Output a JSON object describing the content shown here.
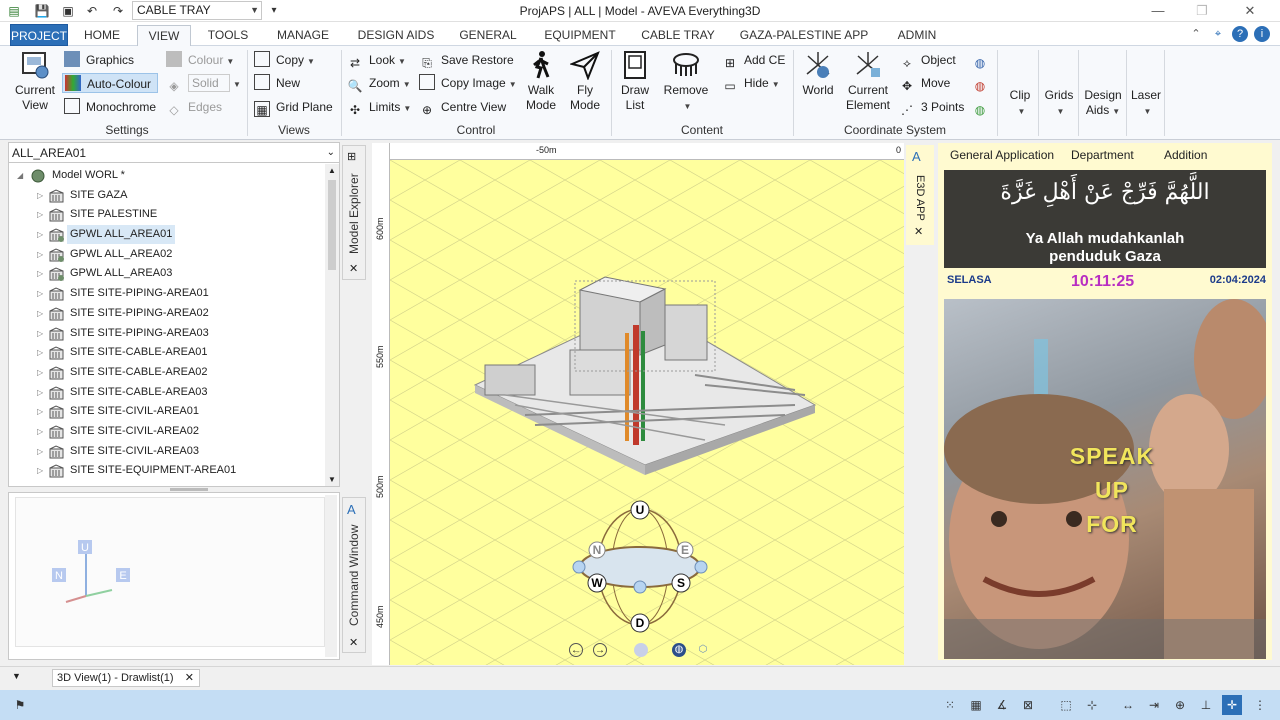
{
  "window": {
    "title": "ProjAPS | ALL | Model - AVEVA Everything3D",
    "context_combo": "CABLE TRAY"
  },
  "tabs": [
    "PROJECT",
    "HOME",
    "VIEW",
    "TOOLS",
    "MANAGE",
    "DESIGN AIDS",
    "GENERAL",
    "EQUIPMENT",
    "CABLE TRAY",
    "GAZA-PALESTINE APP",
    "ADMIN"
  ],
  "active_tab": "VIEW",
  "ribbon": {
    "settings": {
      "label": "Settings",
      "current_view": [
        "Current",
        "View"
      ],
      "graphics": "Graphics",
      "auto_colour": "Auto-Colour",
      "monochrome": "Monochrome",
      "colour": "Colour",
      "solid": "Solid",
      "edges": "Edges"
    },
    "views": {
      "label": "Views",
      "copy": "Copy",
      "new": "New",
      "grid_plane": "Grid Plane"
    },
    "control": {
      "label": "Control",
      "look": "Look",
      "zoom": "Zoom",
      "limits": "Limits",
      "save_restore": "Save Restore",
      "copy_image": "Copy Image",
      "centre_view": "Centre View",
      "walk_mode": [
        "Walk",
        "Mode"
      ],
      "fly_mode": [
        "Fly",
        "Mode"
      ]
    },
    "content": {
      "label": "Content",
      "draw_list": [
        "Draw",
        "List"
      ],
      "remove": "Remove",
      "add_ce": "Add CE",
      "hide": "Hide"
    },
    "coordinate": {
      "label": "Coordinate System",
      "world": "World",
      "current_element": [
        "Current",
        "Element"
      ],
      "object": "Object",
      "move": "Move",
      "three_points": "3 Points"
    },
    "clip": "Clip",
    "grids": "Grids",
    "design_aids": [
      "Design",
      "Aids"
    ],
    "laser": "Laser"
  },
  "explorer": {
    "combo": "ALL_AREA01",
    "side_tab": "Model Explorer",
    "root": "Model WORL *",
    "items": [
      "SITE GAZA",
      "SITE PALESTINE",
      "GPWL ALL_AREA01",
      "GPWL ALL_AREA02",
      "GPWL ALL_AREA03",
      "SITE SITE-PIPING-AREA01",
      "SITE SITE-PIPING-AREA02",
      "SITE SITE-PIPING-AREA03",
      "SITE SITE-CABLE-AREA01",
      "SITE SITE-CABLE-AREA02",
      "SITE SITE-CABLE-AREA03",
      "SITE SITE-CIVIL-AREA01",
      "SITE SITE-CIVIL-AREA02",
      "SITE SITE-CIVIL-AREA03",
      "SITE SITE-EQUIPMENT-AREA01"
    ],
    "selected_index": 2
  },
  "command_window": {
    "side_tab": "Command Window",
    "axis": {
      "u": "U",
      "n": "N",
      "e": "E"
    }
  },
  "viewport": {
    "ruler_top": [
      "-50m",
      "0"
    ],
    "ruler_left": [
      "600m",
      "550m",
      "500m",
      "450m"
    ],
    "navcube": {
      "u": "U",
      "d": "D",
      "n": "N",
      "e": "E",
      "w": "W",
      "s": "S"
    }
  },
  "e3d_app": {
    "side_tab": "E3D APP",
    "menu": [
      "General Application",
      "Department",
      "Addition"
    ],
    "banner_arabic": "اللَّهُمَّ فَرِّجْ عَنْ أَهْلِ غَزَّةَ",
    "banner_line1": "Ya Allah mudahkanlah",
    "banner_line2": "penduduk Gaza",
    "day": "SELASA",
    "time": "10:11:25",
    "date": "02:04:2024",
    "speak": [
      "SPEAK",
      "UP",
      "FOR"
    ]
  },
  "doc_tab": "3D View(1) - Drawlist(1)",
  "colors": {
    "project_tab": "#2c6fb7",
    "viewport_bg": "#ffff9e",
    "status_bar": "#c4ddf4",
    "clock": "#b82ec2"
  }
}
